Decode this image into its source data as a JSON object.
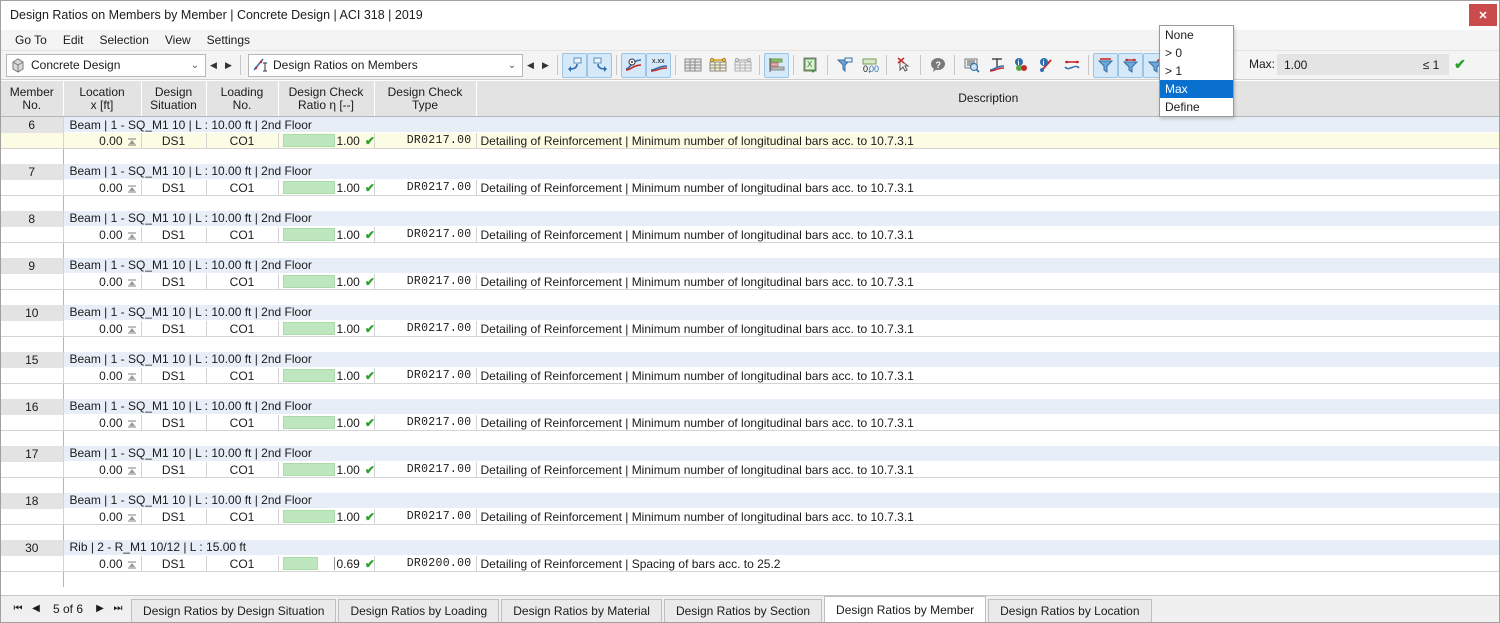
{
  "window": {
    "title": "Design Ratios on Members by Member | Concrete Design | ACI 318 | 2019",
    "close_label": "✕"
  },
  "menu": {
    "items": [
      {
        "label": "Go To"
      },
      {
        "label": "Edit"
      },
      {
        "label": "Selection"
      },
      {
        "label": "View"
      },
      {
        "label": "Settings"
      }
    ]
  },
  "toolbar": {
    "module_combo": {
      "value": "Concrete Design",
      "icon": "beam-icon",
      "arrow": "⌄"
    },
    "table_combo": {
      "value": "Design Ratios on Members",
      "icon": "design-ratio-icon",
      "arrow": "⌄"
    },
    "nav_prev": "◀",
    "nav_next": "▶",
    "buttons": [
      {
        "name": "undo-arrow-icon",
        "active": true
      },
      {
        "name": "redo-arrow-icon",
        "active": true
      },
      {
        "name": "show-result-diagram-icon",
        "active": true
      },
      {
        "name": "show-values-xxx-icon",
        "active": true
      },
      {
        "name": "table-all-icon",
        "active": false
      },
      {
        "name": "table-selected-icon",
        "active": false
      },
      {
        "name": "table-filter-rows-icon",
        "active": false
      },
      {
        "name": "color-bars-icon",
        "active": true
      },
      {
        "name": "export-excel-icon",
        "active": false
      },
      {
        "name": "filter-funnel-icon",
        "active": false
      },
      {
        "name": "decimal-places-icon",
        "active": false
      },
      {
        "name": "clear-selection-icon",
        "active": false
      },
      {
        "name": "help-icon",
        "active": false
      },
      {
        "name": "find-zoom-icon",
        "active": false
      },
      {
        "name": "result-diagram-icon",
        "active": false
      },
      {
        "name": "info-colors-icon",
        "active": false
      },
      {
        "name": "info-member-icon",
        "active": false
      },
      {
        "name": "deformation-icon",
        "active": false
      },
      {
        "name": "filter-max-icon",
        "active": true
      },
      {
        "name": "filter-limit-icon",
        "active": true
      },
      {
        "name": "filter-define-icon",
        "active": true
      }
    ],
    "filter_select": {
      "value": "Max",
      "arrow": "⌄",
      "options": [
        {
          "label": "None",
          "selected": false
        },
        {
          "label": "> 0",
          "selected": false
        },
        {
          "label": "> 1",
          "selected": false
        },
        {
          "label": "Max",
          "selected": true
        },
        {
          "label": "Define",
          "selected": false
        }
      ]
    },
    "max_label": "Max:",
    "max_value": "1.00",
    "limit_label": "≤ 1",
    "ok_check": "✔"
  },
  "table": {
    "columns": [
      {
        "key": "member",
        "header_line1": "Member",
        "header_line2": "No."
      },
      {
        "key": "location",
        "header_line1": "Location",
        "header_line2": "x [ft]"
      },
      {
        "key": "situation",
        "header_line1": "Design",
        "header_line2": "Situation"
      },
      {
        "key": "loading",
        "header_line1": "Loading",
        "header_line2": "No."
      },
      {
        "key": "ratio",
        "header_line1": "Design Check",
        "header_line2": "Ratio η [--]"
      },
      {
        "key": "type",
        "header_line1": "Design Check",
        "header_line2": "Type"
      },
      {
        "key": "description",
        "header_line1": "Description",
        "header_line2": ""
      }
    ],
    "groups": [
      {
        "member_no": "6",
        "header": "Beam | 1 - SQ_M1 10 | L : 10.00 ft | 2nd Floor",
        "selected": true,
        "row": {
          "location": "0.00",
          "situation": "DS1",
          "loading": "CO1",
          "ratio": "1.00",
          "ratio_pct": 100,
          "status": "✔",
          "type": "DR0217.00",
          "description": "Detailing of Reinforcement | Minimum number of longitudinal bars acc. to 10.7.3.1"
        }
      },
      {
        "member_no": "7",
        "header": "Beam | 1 - SQ_M1 10 | L : 10.00 ft | 2nd Floor",
        "selected": false,
        "row": {
          "location": "0.00",
          "situation": "DS1",
          "loading": "CO1",
          "ratio": "1.00",
          "ratio_pct": 100,
          "status": "✔",
          "type": "DR0217.00",
          "description": "Detailing of Reinforcement | Minimum number of longitudinal bars acc. to 10.7.3.1"
        }
      },
      {
        "member_no": "8",
        "header": "Beam | 1 - SQ_M1 10 | L : 10.00 ft | 2nd Floor",
        "selected": false,
        "row": {
          "location": "0.00",
          "situation": "DS1",
          "loading": "CO1",
          "ratio": "1.00",
          "ratio_pct": 100,
          "status": "✔",
          "type": "DR0217.00",
          "description": "Detailing of Reinforcement | Minimum number of longitudinal bars acc. to 10.7.3.1"
        }
      },
      {
        "member_no": "9",
        "header": "Beam | 1 - SQ_M1 10 | L : 10.00 ft | 2nd Floor",
        "selected": false,
        "row": {
          "location": "0.00",
          "situation": "DS1",
          "loading": "CO1",
          "ratio": "1.00",
          "ratio_pct": 100,
          "status": "✔",
          "type": "DR0217.00",
          "description": "Detailing of Reinforcement | Minimum number of longitudinal bars acc. to 10.7.3.1"
        }
      },
      {
        "member_no": "10",
        "header": "Beam | 1 - SQ_M1 10 | L : 10.00 ft | 2nd Floor",
        "selected": false,
        "row": {
          "location": "0.00",
          "situation": "DS1",
          "loading": "CO1",
          "ratio": "1.00",
          "ratio_pct": 100,
          "status": "✔",
          "type": "DR0217.00",
          "description": "Detailing of Reinforcement | Minimum number of longitudinal bars acc. to 10.7.3.1"
        }
      },
      {
        "member_no": "15",
        "header": "Beam | 1 - SQ_M1 10 | L : 10.00 ft | 2nd Floor",
        "selected": false,
        "row": {
          "location": "0.00",
          "situation": "DS1",
          "loading": "CO1",
          "ratio": "1.00",
          "ratio_pct": 100,
          "status": "✔",
          "type": "DR0217.00",
          "description": "Detailing of Reinforcement | Minimum number of longitudinal bars acc. to 10.7.3.1"
        }
      },
      {
        "member_no": "16",
        "header": "Beam | 1 - SQ_M1 10 | L : 10.00 ft | 2nd Floor",
        "selected": false,
        "row": {
          "location": "0.00",
          "situation": "DS1",
          "loading": "CO1",
          "ratio": "1.00",
          "ratio_pct": 100,
          "status": "✔",
          "type": "DR0217.00",
          "description": "Detailing of Reinforcement | Minimum number of longitudinal bars acc. to 10.7.3.1"
        }
      },
      {
        "member_no": "17",
        "header": "Beam | 1 - SQ_M1 10 | L : 10.00 ft | 2nd Floor",
        "selected": false,
        "row": {
          "location": "0.00",
          "situation": "DS1",
          "loading": "CO1",
          "ratio": "1.00",
          "ratio_pct": 100,
          "status": "✔",
          "type": "DR0217.00",
          "description": "Detailing of Reinforcement | Minimum number of longitudinal bars acc. to 10.7.3.1"
        }
      },
      {
        "member_no": "18",
        "header": "Beam | 1 - SQ_M1 10 | L : 10.00 ft | 2nd Floor",
        "selected": false,
        "row": {
          "location": "0.00",
          "situation": "DS1",
          "loading": "CO1",
          "ratio": "1.00",
          "ratio_pct": 100,
          "status": "✔",
          "type": "DR0217.00",
          "description": "Detailing of Reinforcement | Minimum number of longitudinal bars acc. to 10.7.3.1"
        }
      },
      {
        "member_no": "30",
        "header": "Rib | 2 - R_M1 10/12 | L : 15.00 ft",
        "selected": false,
        "row": {
          "location": "0.00",
          "situation": "DS1",
          "loading": "CO1",
          "ratio": "0.69",
          "ratio_pct": 69,
          "status": "✔",
          "type": "DR0200.00",
          "description": "Detailing of Reinforcement | Spacing of bars acc. to 25.2"
        }
      }
    ]
  },
  "bottom": {
    "pager": {
      "first": "⏮",
      "prev": "◀",
      "info": "5 of 6",
      "next": "▶",
      "last": "⏭"
    },
    "tabs": [
      {
        "label": "Design Ratios by Design Situation",
        "active": false
      },
      {
        "label": "Design Ratios by Loading",
        "active": false
      },
      {
        "label": "Design Ratios by Material",
        "active": false
      },
      {
        "label": "Design Ratios by Section",
        "active": false
      },
      {
        "label": "Design Ratios by Member",
        "active": true
      },
      {
        "label": "Design Ratios by Location",
        "active": false
      }
    ]
  },
  "colors": {
    "bar_fill": "#bfe7bf",
    "header_bg": "#e3e3e3",
    "group_header_bg": "#e8eef7",
    "selected_row_bg": "#fcfbe3",
    "dropdown_selected": "#0a70d0",
    "close_button": "#c94b4b",
    "check_green": "#2aa32a"
  }
}
